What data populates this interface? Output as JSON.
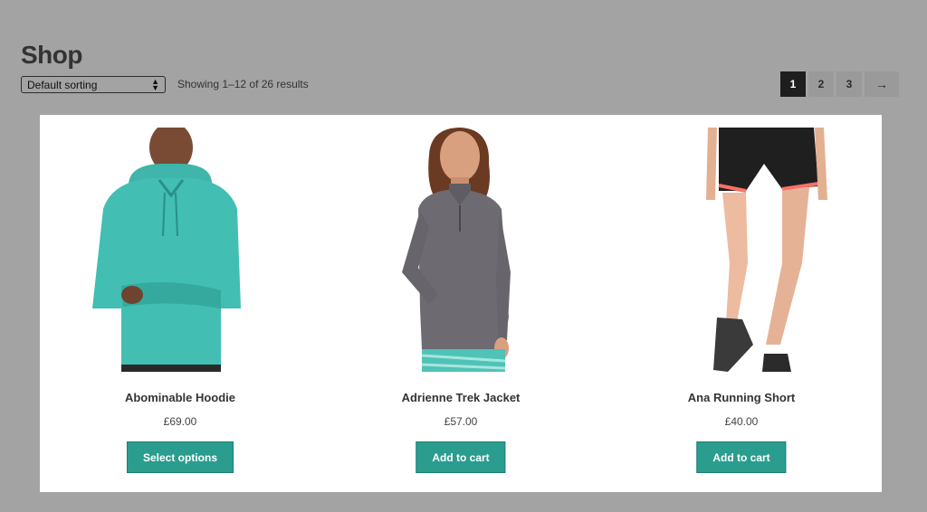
{
  "page": {
    "title": "Shop"
  },
  "toolbar": {
    "sort_selected": "Default sorting",
    "result_count": "Showing 1–12 of 26 results"
  },
  "pagination": {
    "pages": [
      "1",
      "2",
      "3"
    ],
    "current": "1",
    "next_label": "→"
  },
  "products": [
    {
      "name": "Abominable Hoodie",
      "price": "£69.00",
      "button": "Select options",
      "image": "teal-hoodie-man"
    },
    {
      "name": "Adrienne Trek Jacket",
      "price": "£57.00",
      "button": "Add to cart",
      "image": "grey-jacket-woman"
    },
    {
      "name": "Ana Running Short",
      "price": "£40.00",
      "button": "Add to cart",
      "image": "black-running-shorts-legs"
    }
  ],
  "colors": {
    "overlay_bg": "#a3a3a3",
    "button_bg": "#2a9d8f",
    "current_page_bg": "#1e1e1e"
  }
}
